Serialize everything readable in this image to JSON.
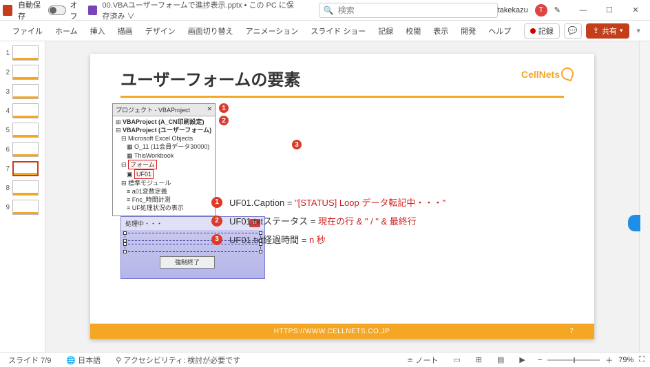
{
  "titlebar": {
    "autosave_label": "自動保存",
    "autosave_off": "オフ",
    "doc_title": "00.VBAユーザーフォームで進捗表示.pptx • この PC に保存済み ∨",
    "search_placeholder": "検索",
    "user": "takekazu",
    "avatar_initial": "T"
  },
  "menu": {
    "tabs": [
      "ファイル",
      "ホーム",
      "挿入",
      "描画",
      "デザイン",
      "画面切り替え",
      "アニメーション",
      "スライド ショー",
      "記録",
      "校閲",
      "表示",
      "開発",
      "ヘルプ"
    ],
    "record": "記録",
    "share": "共有"
  },
  "thumbs": {
    "count": 9,
    "current": 7
  },
  "slide": {
    "title": "ユーザーフォームの要素",
    "logo": "CellNets",
    "pane_title": "プロジェクト - VBAProject",
    "tree": {
      "proj1": "VBAProject (A_CN印刷設定)",
      "proj2": "VBAProject (ユーザーフォーム)",
      "meo": "Microsoft Excel Objects",
      "sheet": "O_11 (11会員データ30000)",
      "wb": "ThisWorkbook",
      "forms_folder": "フォーム",
      "uf": "UF01",
      "modules_folder": "標準モジュール",
      "mod1": "a01変数定義",
      "mod2": "Fnc_時間計測",
      "mod3": "UF処理状況の表示"
    },
    "dialog": {
      "title": "処理中・・・",
      "button": "強制終了"
    },
    "markers": [
      "1",
      "2",
      "3"
    ],
    "lines": {
      "l1_a": "UF01.Caption = ",
      "l1_b": "\"[STATUS] Loop データ転記中・・・\"",
      "l2_a": "UF01.txtステータス = ",
      "l2_b": "現在の行 & \" / \" & 最終行",
      "l3_a": "UF01.txt経過時間 = ",
      "l3_b": "n 秒"
    },
    "footer_url": "HTTPS://WWW.CELLNETS.CO.JP",
    "page_no": "7"
  },
  "status": {
    "slide_pos": "スライド 7/9",
    "lang": "日本語",
    "a11y": "アクセシビリティ: 検討が必要です",
    "notes": "ノート",
    "zoom_pct": "79%"
  }
}
